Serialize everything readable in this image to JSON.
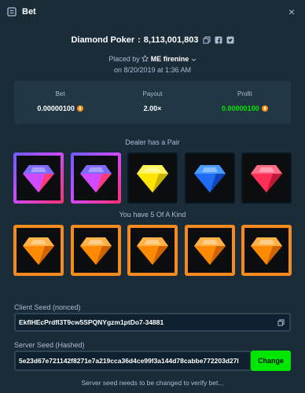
{
  "window": {
    "title": "Bet",
    "close_glyph": "×"
  },
  "bet": {
    "game": "Diamond Poker",
    "id": "8,113,001,803",
    "placed_by_prefix": "Placed by",
    "user": "ME firenine",
    "date": "on 8/20/2019 at 1:36 AM"
  },
  "stats": [
    {
      "label": "Bet",
      "value": "0.00000100",
      "icon": "btc-coin-icon"
    },
    {
      "label": "Payout",
      "value": "2.00×"
    },
    {
      "label": "Profit",
      "value": "0.00000100",
      "icon": "btc-coin-icon",
      "color": "#00e701"
    }
  ],
  "dealer": {
    "label": "Dealer has a Pair",
    "cards": [
      {
        "gem": "purple",
        "highlight": "pair"
      },
      {
        "gem": "purple",
        "highlight": "pair"
      },
      {
        "gem": "yellow",
        "highlight": "none"
      },
      {
        "gem": "blue",
        "highlight": "none"
      },
      {
        "gem": "red",
        "highlight": "none"
      }
    ]
  },
  "player": {
    "label": "You have 5 Of A Kind",
    "cards": [
      {
        "gem": "orange",
        "highlight": "win"
      },
      {
        "gem": "orange",
        "highlight": "win"
      },
      {
        "gem": "orange",
        "highlight": "win"
      },
      {
        "gem": "orange",
        "highlight": "win"
      },
      {
        "gem": "orange",
        "highlight": "win"
      }
    ]
  },
  "seeds": {
    "client_label": "Client Seed (nonced)",
    "client_value": "EkfIHEcPrdfI3T9cw5SPQNYgzm1ptDo7-34881",
    "server_label": "Server Seed (Hashed)",
    "server_value": "5e23d67e721142f8271e7a219cca36d4ce99f3a144d78cabbe772203d27l",
    "change_label": "Change",
    "note": "Server seed needs to be changed to verify bet..."
  },
  "colors": {
    "background": "#1a2c38",
    "panel": "#213743",
    "win_border": "#f58a1f",
    "profit": "#00e701",
    "button": "#00e701"
  },
  "gem_colors": {
    "purple": [
      "#7b6cff",
      "#d04bff",
      "#ff3b76"
    ],
    "yellow": [
      "#fff35a",
      "#ffe600",
      "#c9b400"
    ],
    "blue": [
      "#4a9bff",
      "#1f6df5",
      "#0f45b8"
    ],
    "red": [
      "#ff6a86",
      "#ff2f55",
      "#c01739"
    ],
    "orange": [
      "#ffb347",
      "#ff8a00",
      "#d06400"
    ]
  }
}
